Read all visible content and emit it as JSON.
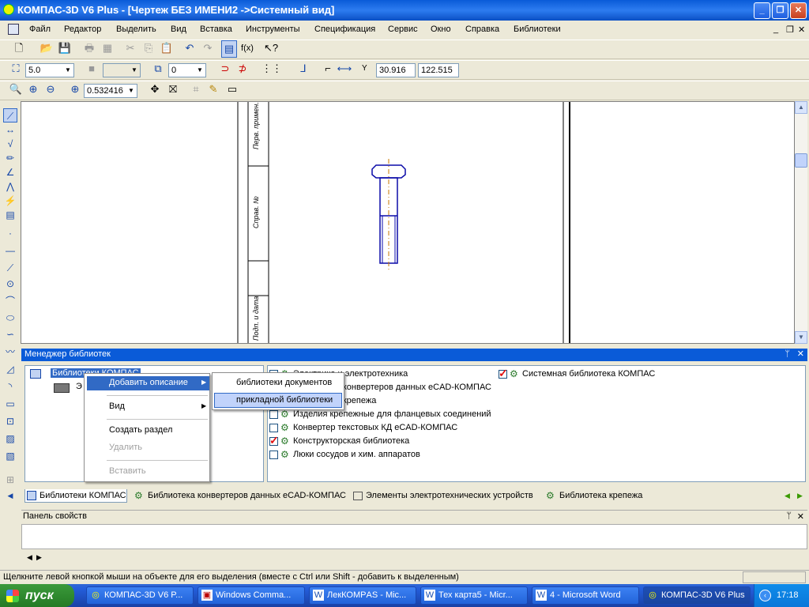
{
  "window": {
    "title": "КОМПАС-3D V6 Plus - [Чертеж БЕЗ ИМЕНИ2 ->Системный вид]",
    "minimize_icon": "_",
    "restore_icon": "❐",
    "close_icon": "✕"
  },
  "menu": [
    "Файл",
    "Редактор",
    "Выделить",
    "Вид",
    "Вставка",
    "Инструменты",
    "Спецификация",
    "Сервис",
    "Окно",
    "Справка",
    "Библиотеки"
  ],
  "mdi_controls": {
    "minimize": "_",
    "restore": "❐",
    "close": "✕"
  },
  "toolbar_current": {
    "step_value": "5.0",
    "layer_value": "0",
    "x_label": "Y",
    "coord_x": "30.916",
    "coord_y": "122.515"
  },
  "toolbar_view": {
    "zoom_value": "0.532416"
  },
  "drawing_frame_labels": [
    "Перв. примен.",
    "Справ. №",
    "Подп. и дата"
  ],
  "library_manager": {
    "title": "Менеджер библиотек",
    "pin_icon": "ᛘ",
    "close_icon": "✕",
    "tree_root": "Библиотеки КОМПАС",
    "tree_child": "Э",
    "libraries_col1": [
      "Электрика и электротехника",
      "Библиотека конвертеров данных eCAD-КОМПАС",
      "Библиотека крепежа",
      "Изделия крепежные для фланцевых соединений",
      "Конвертер текстовых КД eCAD-КОМПАС",
      "Конструкторская библиотека",
      "Люки сосудов и хим. аппаратов"
    ],
    "libraries_col2": [
      "Системная библиотека КОМПАС"
    ]
  },
  "context_menu": {
    "add_description": "Добавить описание",
    "view": "Вид",
    "create_section": "Создать раздел",
    "delete": "Удалить",
    "paste": "Вставить",
    "arrow": "▶"
  },
  "submenu": {
    "documents_library": "библиотеки документов",
    "applied_library": "прикладной библиотеки"
  },
  "library_tabs": [
    "Библиотеки КОМПАС",
    "Библиотека конвертеров данных eCAD-КОМПАС",
    "Элементы электротехнических устройств",
    "Библиотека крепежа"
  ],
  "properties_panel": {
    "title": "Панель свойств"
  },
  "status_text": "Щелкните левой кнопкой мыши на объекте для его выделения (вместе с Ctrl или Shift - добавить к выделенным)",
  "taskbar": {
    "start": "пуск",
    "tasks": [
      "КОМПАС-3D V6 P...",
      "Windows Comma...",
      "ЛекКОМРAS - Mic...",
      "Тех карта5 - Micr...",
      "4 - Microsoft Word",
      "КОМПАС-3D V6 Plus"
    ],
    "clock": "17:18"
  },
  "colors": {
    "titlebar": "#0a5bd8",
    "taskbar": "#245edb",
    "start": "#2f8a2f",
    "check_red": "#e01010"
  }
}
